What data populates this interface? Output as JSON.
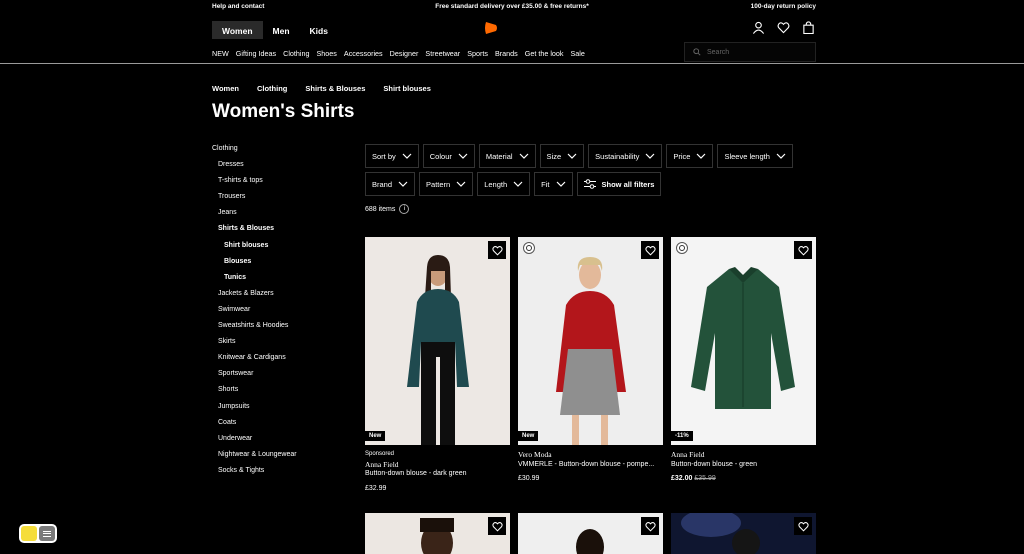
{
  "topbar": {
    "left": "Help and contact",
    "center": "Free standard delivery over £35.00 & free returns*",
    "right": "100-day return policy"
  },
  "gender": [
    "Women",
    "Men",
    "Kids"
  ],
  "catnav": [
    "NEW",
    "Gifting Ideas",
    "Clothing",
    "Shoes",
    "Accessories",
    "Designer",
    "Streetwear",
    "Sports",
    "Brands",
    "Get the look",
    "Sale"
  ],
  "search": {
    "placeholder": "Search"
  },
  "breadcrumb": [
    "Women",
    "Clothing",
    "Shirts & Blouses",
    "Shirt blouses"
  ],
  "title": "Women's Shirts",
  "sidebar": {
    "top": "Clothing",
    "items": [
      "Dresses",
      "T-shirts & tops",
      "Trousers",
      "Jeans",
      "Shirts & Blouses"
    ],
    "sub": [
      "Shirt blouses",
      "Blouses",
      "Tunics"
    ],
    "rest": [
      "Jackets & Blazers",
      "Swimwear",
      "Sweatshirts & Hoodies",
      "Skirts",
      "Knitwear & Cardigans",
      "Sportswear",
      "Shorts",
      "Jumpsuits",
      "Coats",
      "Underwear",
      "Nightwear & Loungewear",
      "Socks & Tights"
    ]
  },
  "filters": {
    "row1": [
      "Sort by",
      "Colour",
      "Material",
      "Size",
      "Sustainability",
      "Price",
      "Sleeve length"
    ],
    "row2": [
      "Brand",
      "Pattern",
      "Length",
      "Fit"
    ],
    "show_all": "Show all filters"
  },
  "count": "688 items",
  "products": [
    {
      "badge": "New",
      "sponsored": "Sponsored",
      "brand": "Anna Field",
      "name": "Button-down blouse - dark green",
      "price": "£32.99",
      "old_price": ""
    },
    {
      "badge": "New",
      "sponsored": "",
      "brand": "Vero Moda",
      "name": "VMMERLE - Button-down blouse - pompe...",
      "price": "£30.99",
      "old_price": ""
    },
    {
      "badge": "-11%",
      "sponsored": "",
      "brand": "Anna Field",
      "name": "Button-down blouse - green",
      "price": "£32.00",
      "old_price": "£35.99"
    }
  ],
  "colors": {
    "accent": "#ff6900",
    "shirt_teal": "#1f4a4f",
    "shirt_red": "#b3161b",
    "shirt_green": "#23523a"
  }
}
